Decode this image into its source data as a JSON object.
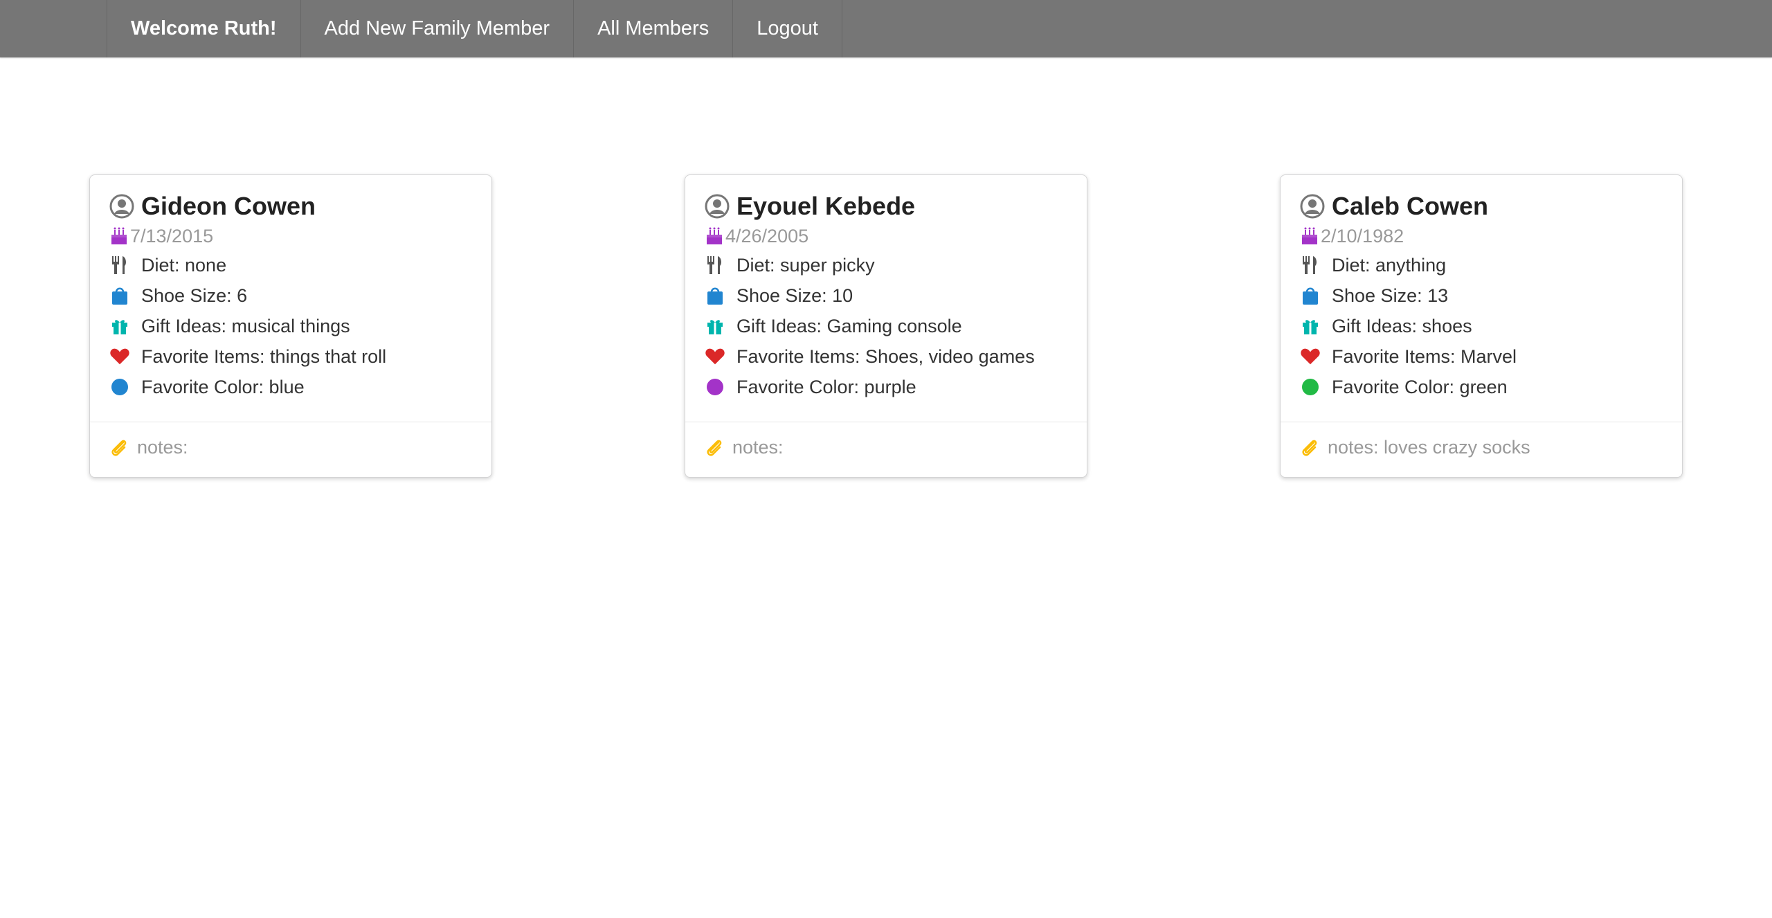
{
  "nav": {
    "welcome": "Welcome Ruth!",
    "add_member": "Add New Family Member",
    "all_members": "All Members",
    "logout": "Logout"
  },
  "colors": {
    "navbar": "#767676",
    "cake": "#a333c8",
    "bag": "#2185d0",
    "gift": "#00b5ad",
    "heart": "#db2828",
    "clip": "#fbbd08",
    "utensils": "#555555",
    "avatar": "#767676"
  },
  "cards": [
    {
      "name": "Gideon Cowen",
      "birthday": "7/13/2015",
      "diet": "Diet: none",
      "shoe": "Shoe Size: 6",
      "gift": "Gift Ideas: musical things",
      "favorites": "Favorite Items: things that roll",
      "color_label": "Favorite Color: blue",
      "color_value": "#2185d0",
      "notes": "notes:"
    },
    {
      "name": "Eyouel Kebede",
      "birthday": "4/26/2005",
      "diet": "Diet: super picky",
      "shoe": "Shoe Size: 10",
      "gift": "Gift Ideas: Gaming console",
      "favorites": "Favorite Items: Shoes, video games",
      "color_label": "Favorite Color: purple",
      "color_value": "#a333c8",
      "notes": "notes:"
    },
    {
      "name": "Caleb Cowen",
      "birthday": "2/10/1982",
      "diet": "Diet: anything",
      "shoe": "Shoe Size: 13",
      "gift": "Gift Ideas: shoes",
      "favorites": "Favorite Items: Marvel",
      "color_label": "Favorite Color: green",
      "color_value": "#21ba45",
      "notes": "notes: loves crazy socks"
    }
  ],
  "icons": {
    "avatar": "user-circle-icon",
    "birthday": "birthday-cake-icon",
    "diet": "utensils-icon",
    "shoe": "shopping-bag-icon",
    "gift": "gift-icon",
    "favorites": "heart-icon",
    "color": "circle-icon",
    "notes": "paperclip-icon"
  }
}
